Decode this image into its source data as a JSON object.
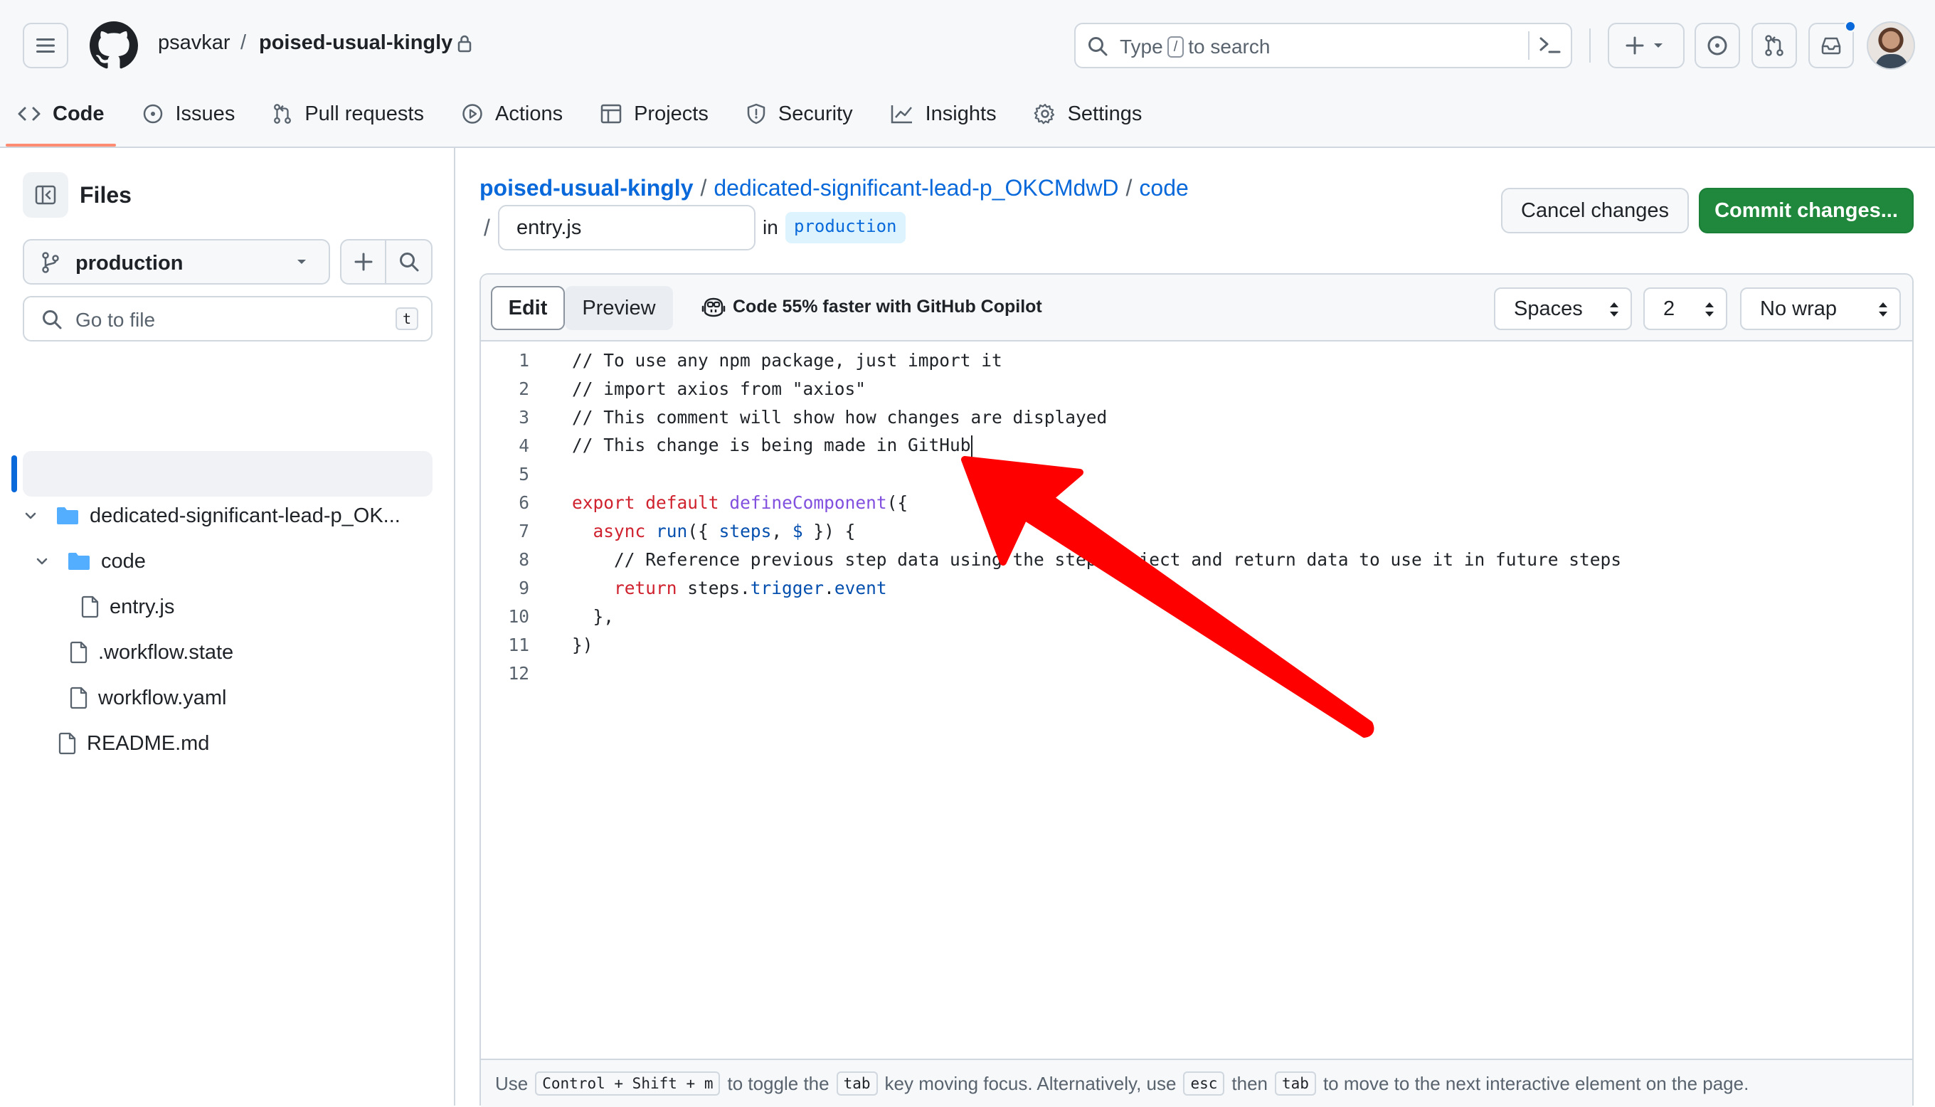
{
  "header": {
    "owner": "psavkar",
    "separator": "/",
    "repo": "poised-usual-kingly",
    "search": {
      "before": "Type",
      "key": "/",
      "after": "to search"
    }
  },
  "repo_nav": {
    "tabs": [
      {
        "label": "Code",
        "icon": "code-icon",
        "selected": true
      },
      {
        "label": "Issues",
        "icon": "issue-icon"
      },
      {
        "label": "Pull requests",
        "icon": "pull-request-icon"
      },
      {
        "label": "Actions",
        "icon": "play-icon"
      },
      {
        "label": "Projects",
        "icon": "table-icon"
      },
      {
        "label": "Security",
        "icon": "shield-icon"
      },
      {
        "label": "Insights",
        "icon": "graph-icon"
      },
      {
        "label": "Settings",
        "icon": "gear-icon"
      }
    ]
  },
  "sidebar": {
    "title": "Files",
    "branch": "production",
    "goto_placeholder": "Go to file",
    "goto_key": "t",
    "tree": [
      {
        "label": "dedicated-significant-lead-p_OK...",
        "type": "folder",
        "open": true
      },
      {
        "label": "code",
        "type": "folder",
        "open": true
      },
      {
        "label": "entry.js",
        "type": "file",
        "selected": true
      },
      {
        "label": ".workflow.state",
        "type": "file"
      },
      {
        "label": "workflow.yaml",
        "type": "file"
      },
      {
        "label": "README.md",
        "type": "file"
      }
    ]
  },
  "main": {
    "breadcrumb": {
      "repo": "poised-usual-kingly",
      "folder": "dedicated-significant-lead-p_OKCMdwD",
      "subfolder": "code",
      "sep": "/"
    },
    "path_slash": "/",
    "filename": "entry.js",
    "in_label": "in",
    "branch": "production",
    "cancel_label": "Cancel changes",
    "commit_label": "Commit changes..."
  },
  "editor": {
    "edit_tab": "Edit",
    "preview_tab": "Preview",
    "copilot_promo": "Code 55% faster with GitHub Copilot",
    "indent_mode": "Spaces",
    "indent_size": "2",
    "wrap_mode": "No wrap",
    "lines": [
      "// To use any npm package, just import it",
      "// import axios from \"axios\"",
      "// This comment will show how changes are displayed",
      "// This change is being made in GitHub",
      "",
      "export default defineComponent({",
      "  async run({ steps, $ }) {",
      "    // Reference previous step data using the steps object and return data to use it in future steps",
      "    return steps.trigger.event",
      "  },",
      "})",
      ""
    ],
    "footer": {
      "t1": "Use",
      "k1": "Control + Shift + m",
      "t2": "to toggle the",
      "k2": "tab",
      "t3": "key moving focus. Alternatively, use",
      "k3": "esc",
      "t4": "then",
      "k4": "tab",
      "t5": "to move to the next interactive element on the page."
    }
  },
  "colors": {
    "accent_blue": "#0969da",
    "commit_green": "#1f883d",
    "selected_underline": "#fd8c73",
    "annotation_arrow": "#ff0000"
  }
}
